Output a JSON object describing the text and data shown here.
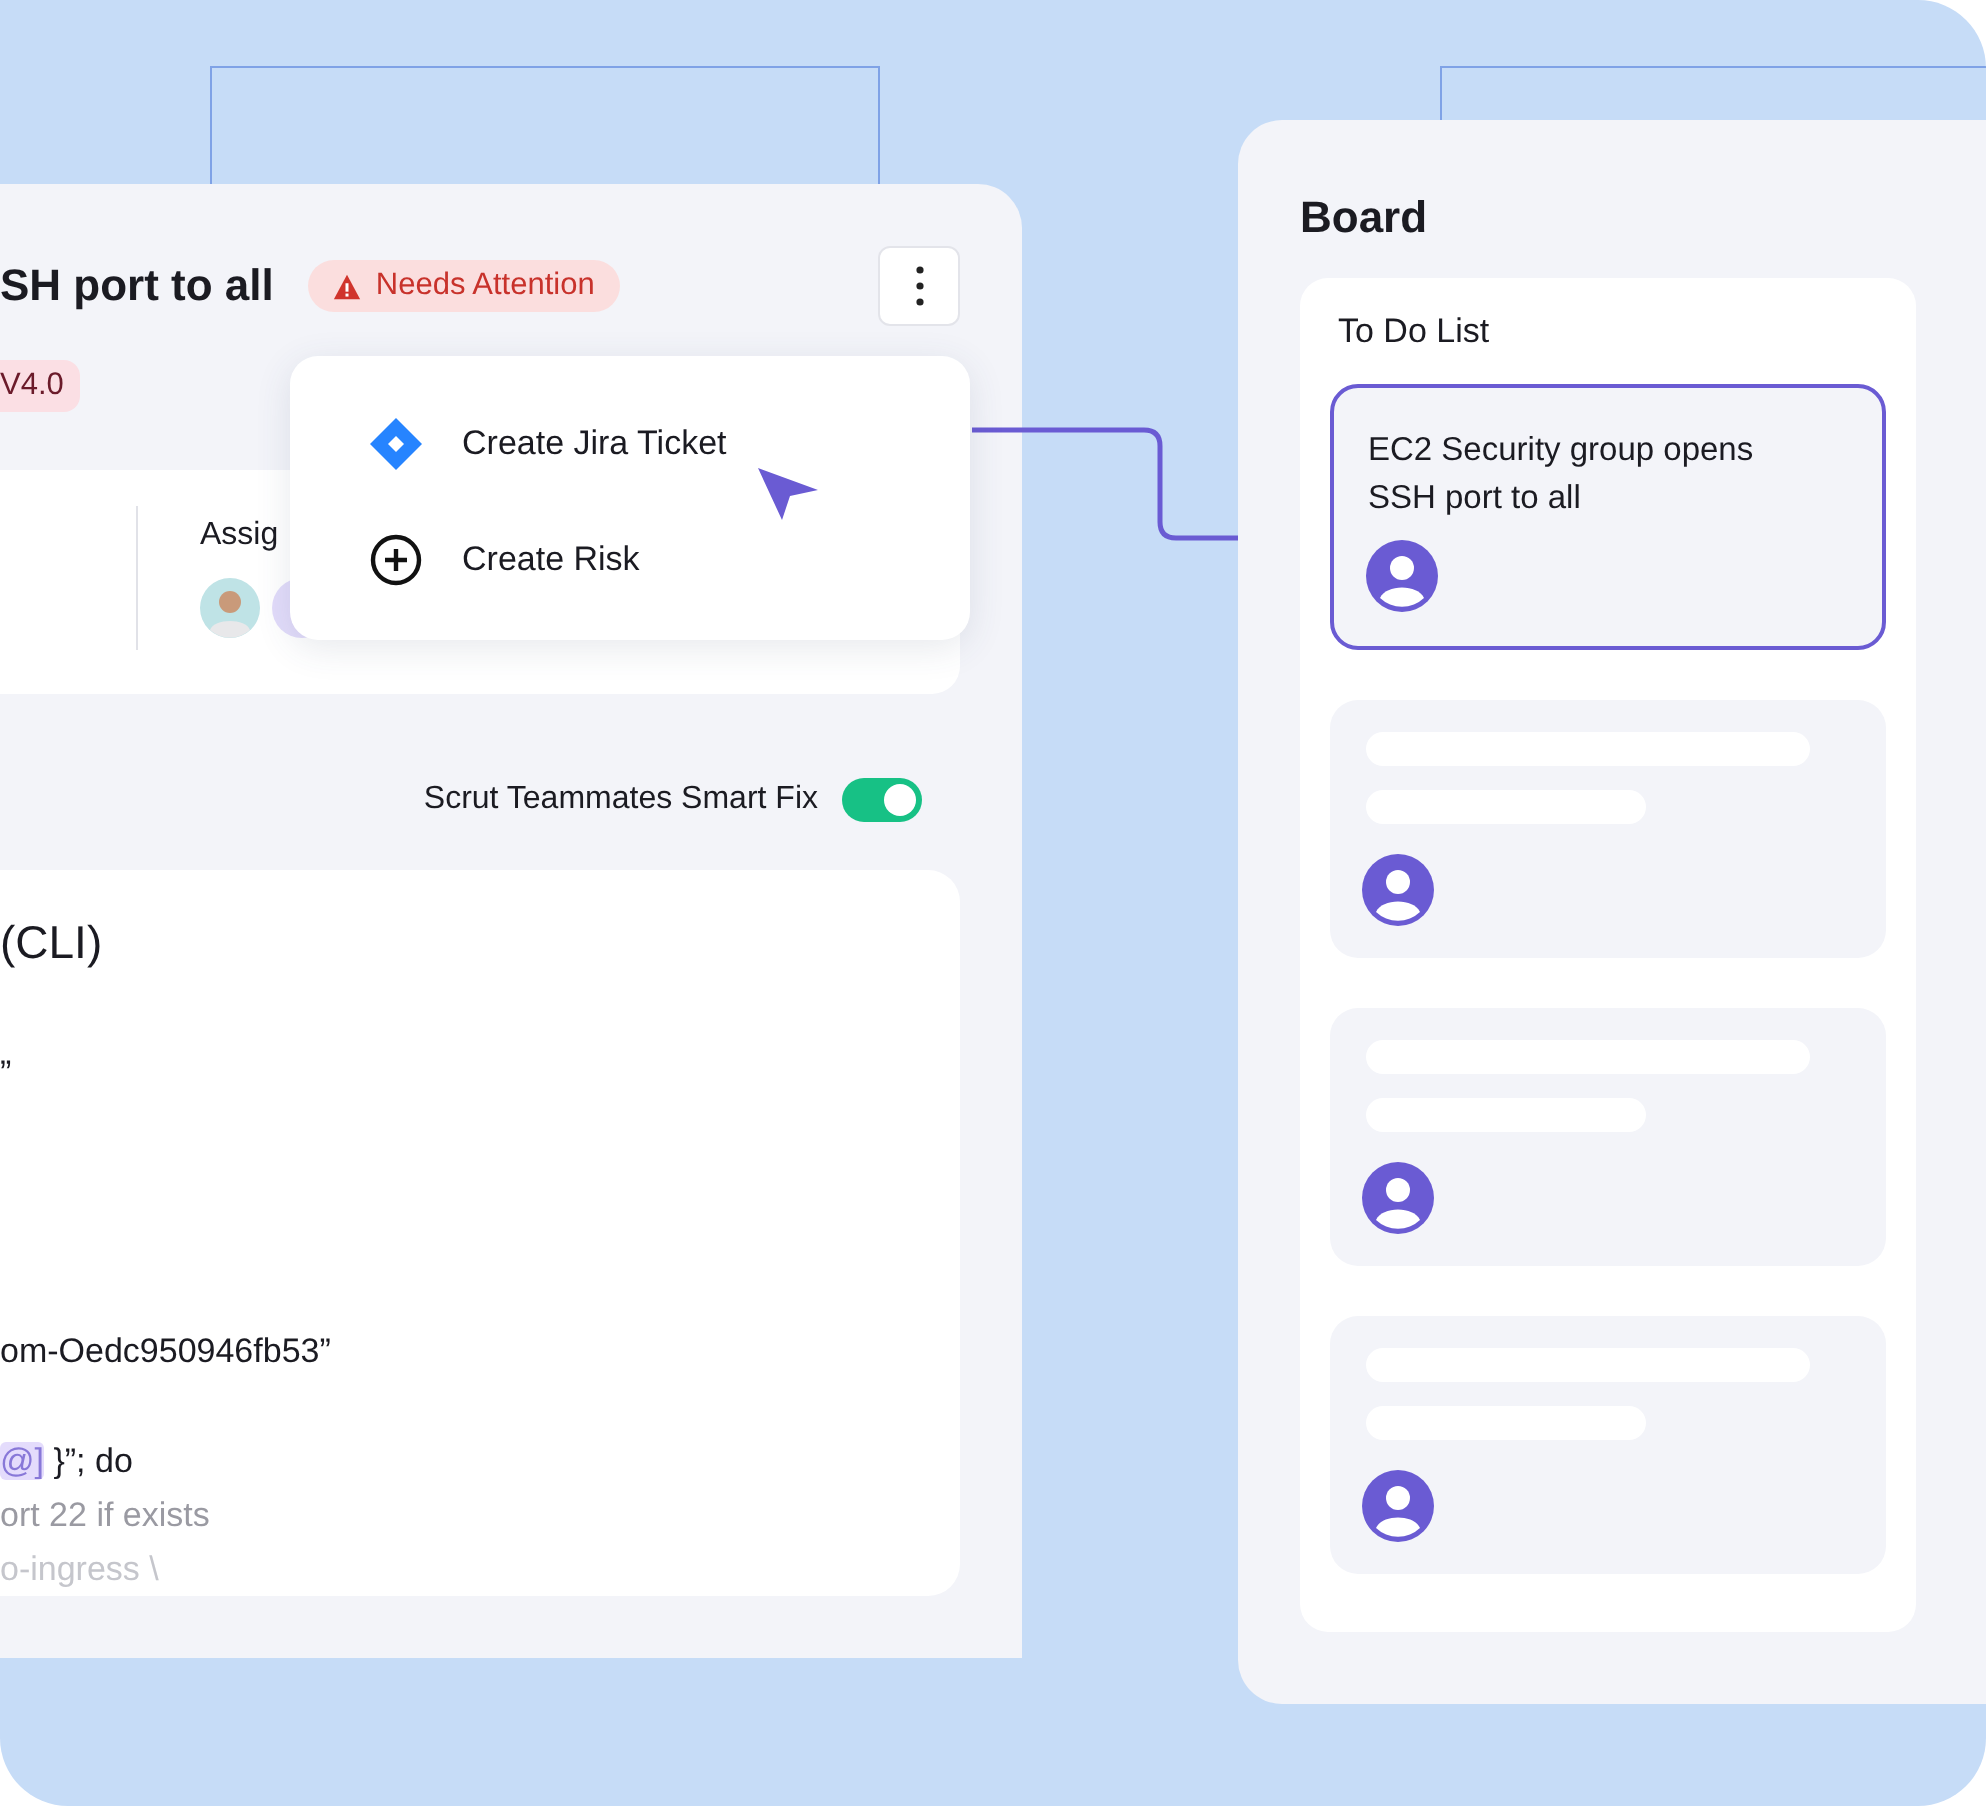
{
  "issue_panel": {
    "title": "SH port to all",
    "status_badge": {
      "label": "Needs Attention",
      "kind": "warning"
    },
    "version_tag": "V4.0",
    "assignee_label": "Assig",
    "smart_fix": {
      "label": "Scrut Teammates Smart Fix",
      "on": true
    },
    "code": {
      "heading": "(CLI)",
      "lines": [
        {
          "kind": "code",
          "parts": [
            {
              "text": "”",
              "highlight": false
            }
          ]
        },
        {
          "kind": "code",
          "parts": [
            {
              "text": "om-Oedc950946fb53”",
              "highlight": false
            }
          ]
        },
        {
          "kind": "code",
          "parts": [
            {
              "text": "@]",
              "highlight": true
            },
            {
              "text": " }”; do",
              "highlight": false
            }
          ]
        },
        {
          "kind": "comment",
          "parts": [
            {
              "text": "ort 22 if exists",
              "highlight": false
            }
          ]
        },
        {
          "kind": "faded",
          "parts": [
            {
              "text": "o-ingress \\",
              "highlight": false
            }
          ]
        }
      ]
    }
  },
  "menu": {
    "items": [
      {
        "label": "Create Jira Ticket",
        "kind": "jira"
      },
      {
        "label": "Create Risk",
        "kind": "add"
      }
    ]
  },
  "board": {
    "title": "Board",
    "column": {
      "title": "To Do List",
      "cards": [
        {
          "kind": "task",
          "title": "EC2 Security group opens SSH port to all",
          "selected": true
        },
        {
          "kind": "skeleton",
          "selected": false
        },
        {
          "kind": "skeleton",
          "selected": false
        },
        {
          "kind": "skeleton",
          "selected": false
        }
      ]
    }
  }
}
